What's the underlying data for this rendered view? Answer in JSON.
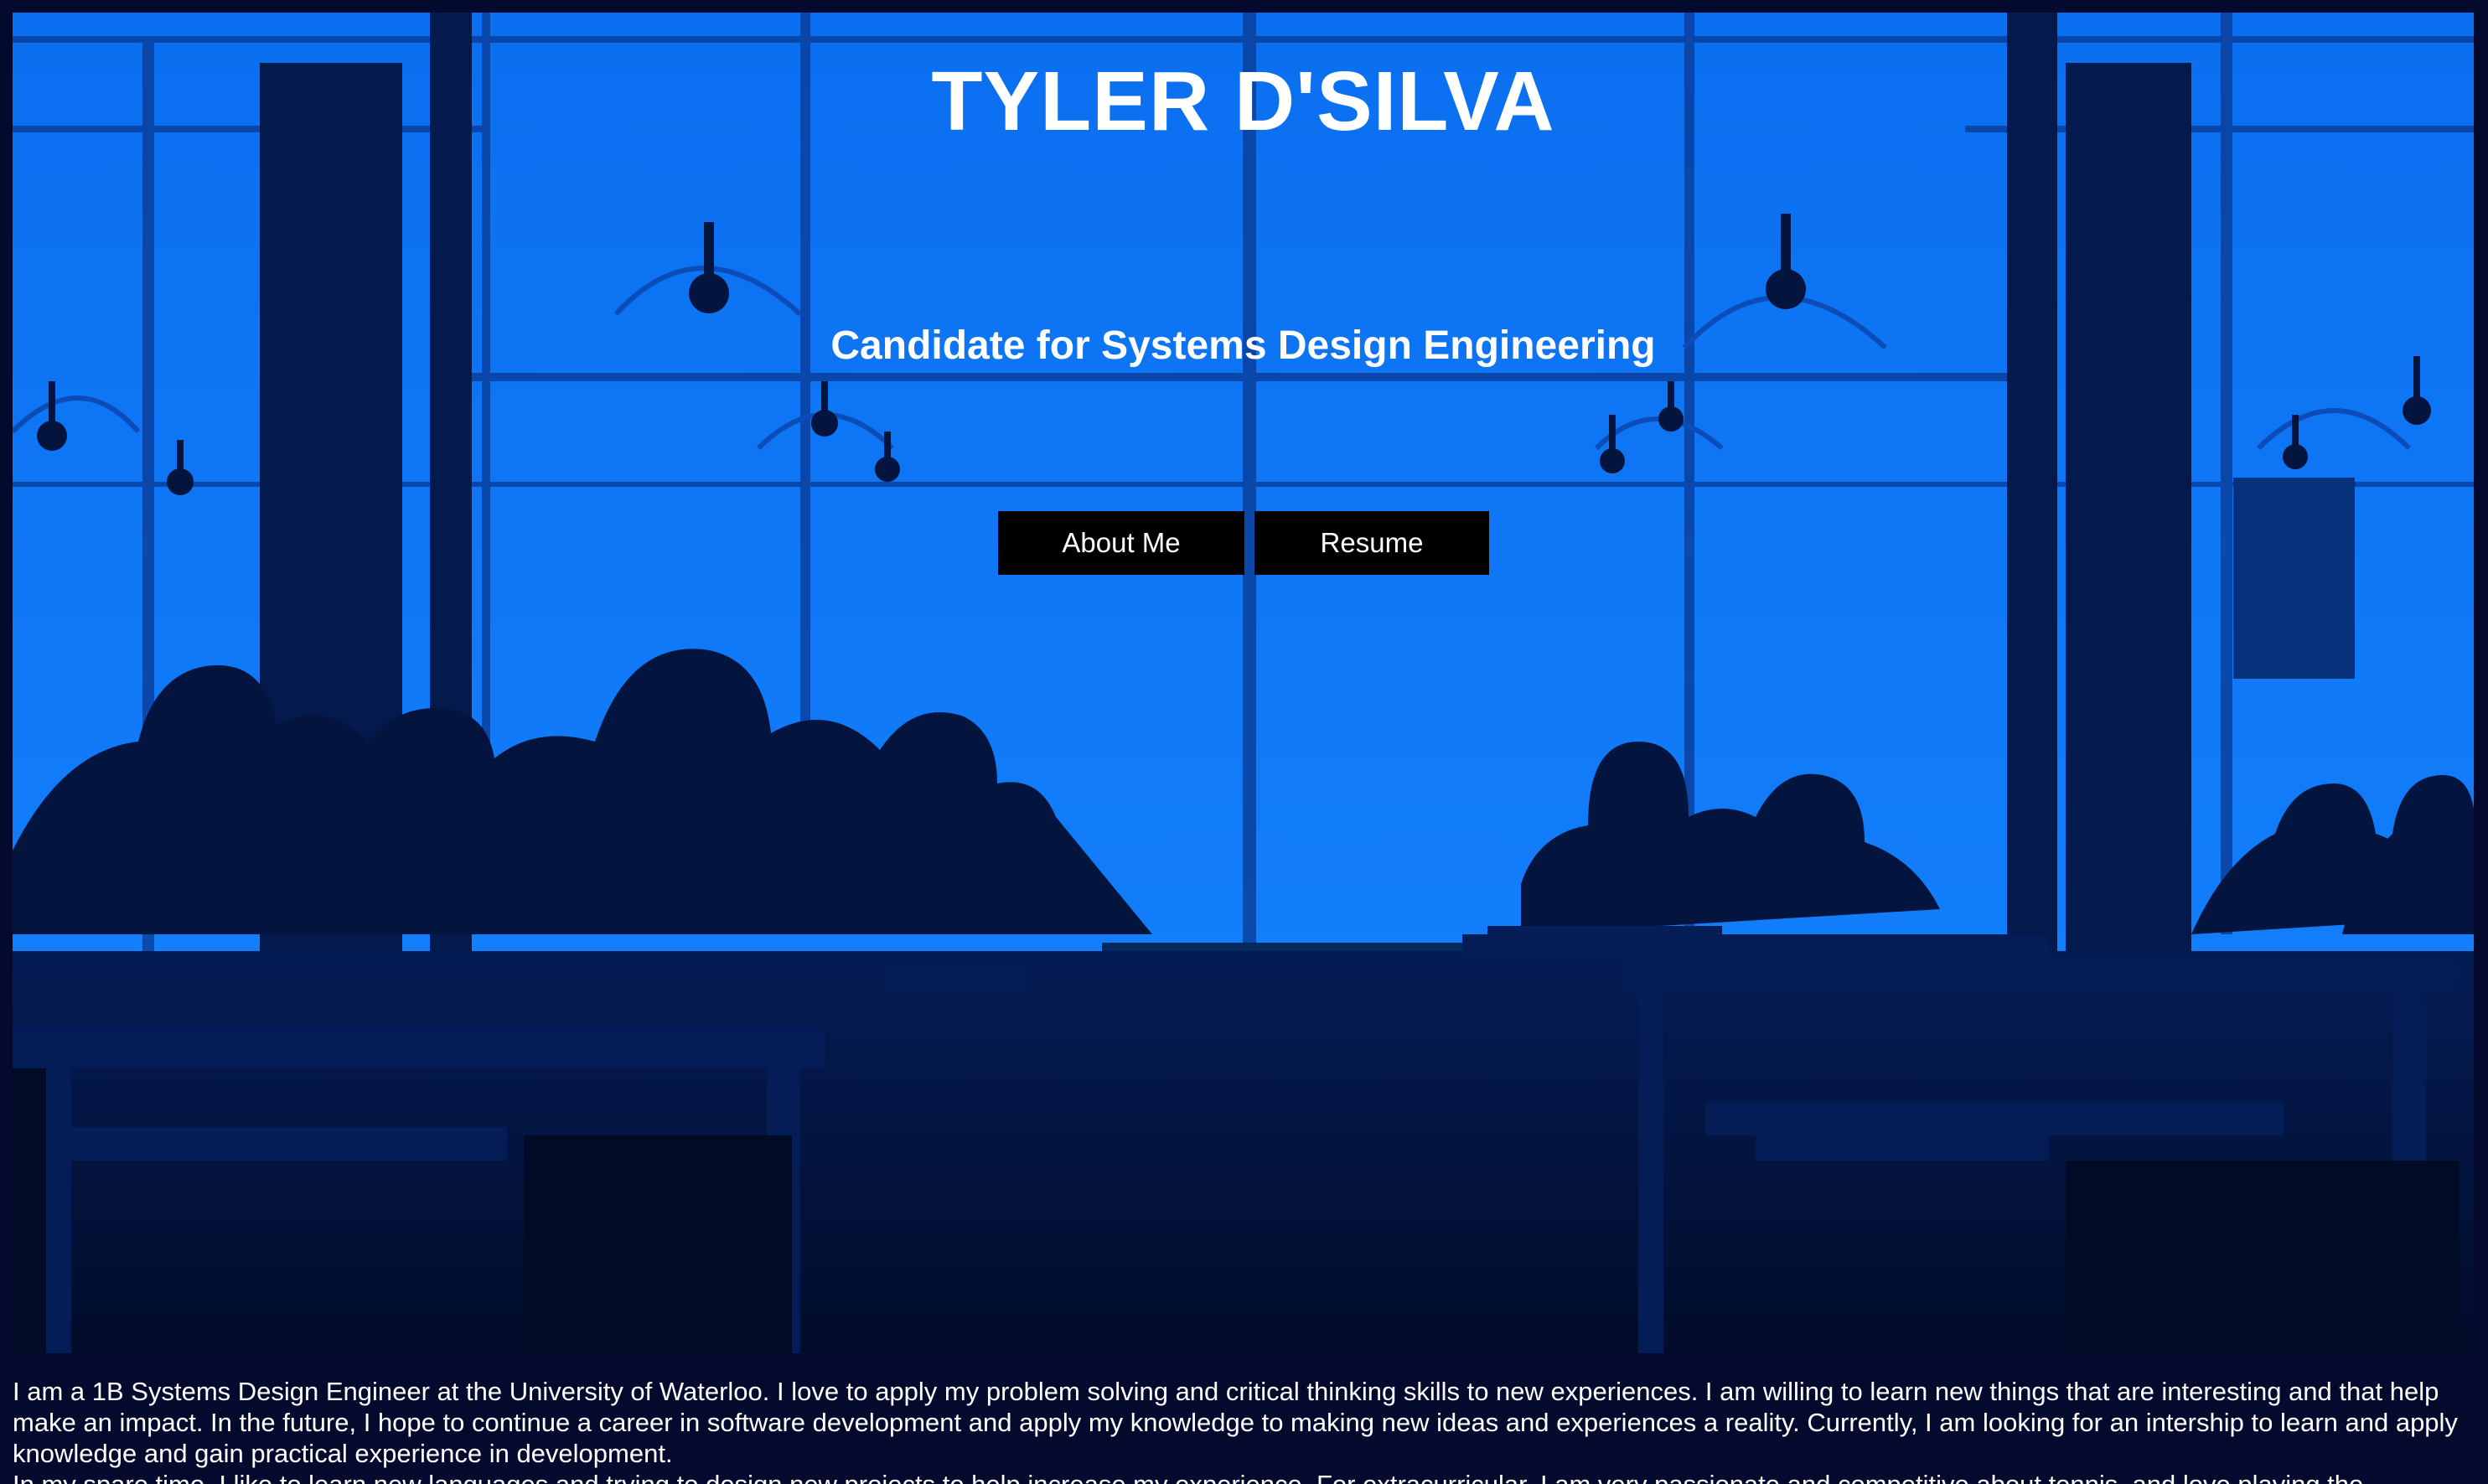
{
  "hero": {
    "title": "TYLER D'SILVA",
    "subtitle": "Candidate for Systems Design Engineering",
    "background_color": "#0d75f5",
    "silhouette_color": "#03153f"
  },
  "nav": {
    "about_label": "About Me",
    "resume_label": "Resume"
  },
  "bio": {
    "paragraph_1": "I am a 1B Systems Design Engineer at the University of Waterloo. I love to apply my problem solving and critical thinking skills to new experiences. I am willing to learn new things that are interesting and that help make an impact. In the future, I hope to continue a career in software development and apply my knowledge to making new ideas and experiences a reality. Currently, I am looking for an intership to learn and apply knowledge and gain practical experience in development.",
    "paragraph_2": "In my spare time, I like to learn new languages and trying to design new projects to help increase my experience. For extracurricular, I am very passionate and competitive about tennis, and love playing the"
  },
  "page": {
    "background_color": "#030a2e",
    "text_color": "#ffffff"
  }
}
